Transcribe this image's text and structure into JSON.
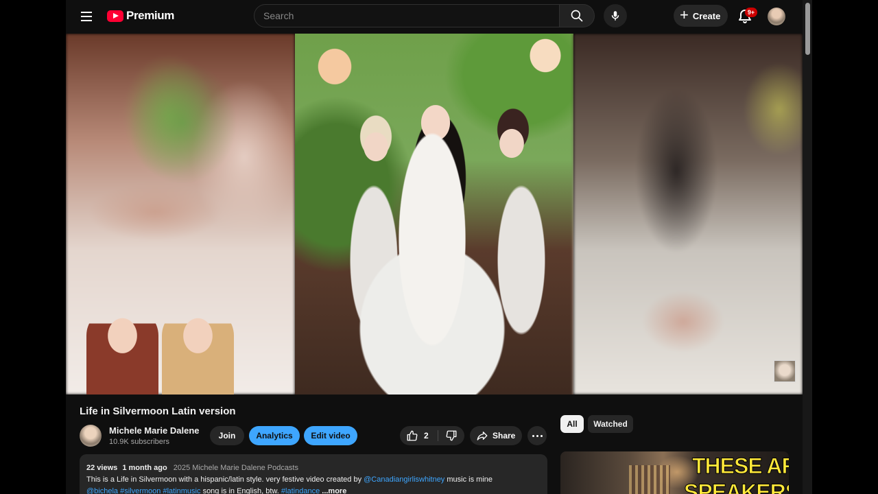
{
  "header": {
    "logo_text": "Premium",
    "search_placeholder": "Search",
    "create_label": "Create",
    "notification_badge": "9+"
  },
  "video": {
    "title": "Life in Silvermoon Latin version",
    "channel": {
      "name": "Michele Marie Dalene",
      "subscribers": "10.9K subscribers"
    },
    "buttons": {
      "join": "Join",
      "analytics": "Analytics",
      "edit": "Edit video",
      "share": "Share"
    },
    "likes": "2",
    "description": {
      "views": "22 views",
      "age": "1 month ago",
      "copyright": "2025 Michele Marie Dalene Podcasts",
      "line1_text": "This is a Life in Silvermoon with a hispanic/latin style. very festive video created by",
      "mention": "@Canadiangirliswhitney",
      "line1_tail": "music is mine",
      "tag1": "@bichela",
      "tag2": "#silvermoon",
      "tag3": "#latinmusic",
      "line2_mid": "song is in English, btw.",
      "tag4": "#latindance",
      "more": "...more"
    }
  },
  "sidebar": {
    "chips": [
      "All",
      "Watched"
    ],
    "recommended": {
      "thumb_line1": "THESE ARE",
      "thumb_line2": "SPEAKERS"
    }
  },
  "colors": {
    "accent_blue": "#3ea6ff",
    "brand_red": "#ff0033",
    "background": "#0f0f0f",
    "thumb_text_yellow": "#ffe83a"
  },
  "icons": [
    "menu-icon",
    "youtube-logo-icon",
    "search-icon",
    "mic-icon",
    "plus-icon",
    "bell-icon",
    "thumbs-up-icon",
    "thumbs-down-icon",
    "share-icon",
    "more-icon"
  ]
}
